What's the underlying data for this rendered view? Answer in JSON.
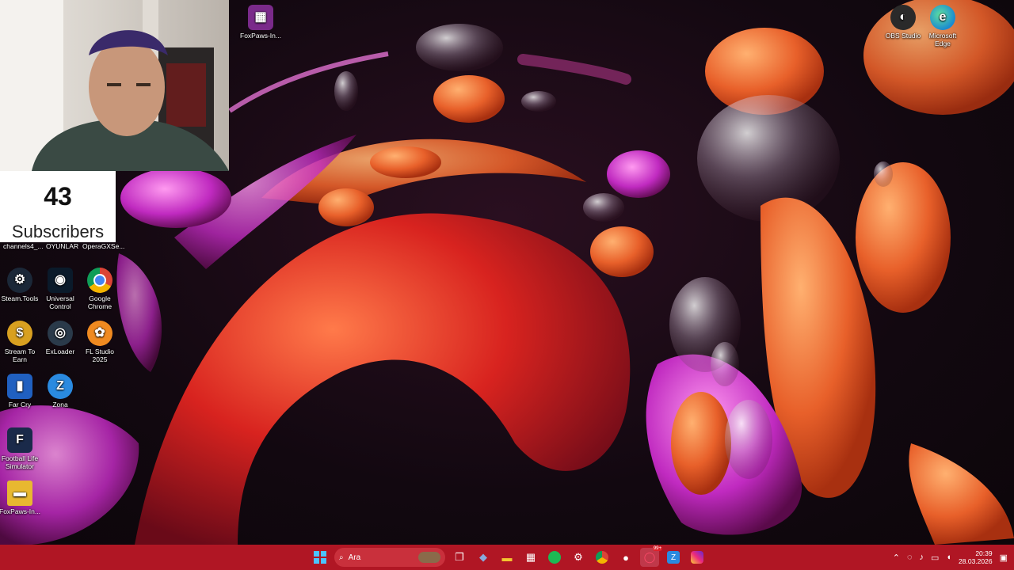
{
  "overlay": {
    "subscriber_count": "43",
    "subscriber_label": "Subscribers"
  },
  "desktop": {
    "top_labels": [
      "channels4_...",
      "OYUNLAR",
      "OperaGXSe..."
    ],
    "icons": [
      {
        "name": "foxpaws-top",
        "label": "FoxPaws-In...",
        "icon": "winrar-icon",
        "color": "#7a2a8a"
      },
      {
        "name": "steam-tools",
        "label": "Steam.Tools",
        "icon": "steam-icon",
        "color": "#1b2838"
      },
      {
        "name": "universal-control",
        "label": "Universal Control",
        "icon": "universal-control-icon",
        "color": "#0a1a2a"
      },
      {
        "name": "google-chrome",
        "label": "Google Chrome",
        "icon": "chrome-icon",
        "color": "#e8e8e8"
      },
      {
        "name": "stream-to-earn",
        "label": "Stream To Earn",
        "icon": "coin-icon",
        "color": "#d8a020"
      },
      {
        "name": "exloader",
        "label": "ExLoader",
        "icon": "exloader-icon",
        "color": "#2a3a4a"
      },
      {
        "name": "fl-studio",
        "label": "FL Studio 2025",
        "icon": "fl-studio-icon",
        "color": "#f08a20"
      },
      {
        "name": "far-cry",
        "label": "Far Cry",
        "icon": "far-cry-icon",
        "color": "#2060c0"
      },
      {
        "name": "zona",
        "label": "Zona",
        "icon": "zona-icon",
        "color": "#2a8ae0"
      },
      {
        "name": "football-life",
        "label": "Football Life Simulator",
        "icon": "fls-icon",
        "color": "#1a2a4a"
      },
      {
        "name": "foxpaws-folder",
        "label": "FoxPaws-In...",
        "icon": "folder-icon",
        "color": "#e8b830"
      },
      {
        "name": "obs-studio",
        "label": "OBS Studio",
        "icon": "obs-icon",
        "color": "#2a2a2a"
      },
      {
        "name": "microsoft-edge",
        "label": "Microsoft Edge",
        "icon": "edge-icon",
        "color": "#1a8ad0"
      }
    ]
  },
  "taskbar": {
    "search_placeholder": "Ara",
    "apps": [
      "windows-start-icon",
      "search-icon",
      "task-view-icon",
      "widgets-icon",
      "file-explorer-icon",
      "store-icon",
      "spotify-icon",
      "steam-icon",
      "chrome-icon",
      "github-icon",
      "opera-gx-icon",
      "zona-icon",
      "instagram-icon"
    ],
    "notification_badge": "99+",
    "clock_time": "20:39",
    "clock_date": "28.03.2026"
  }
}
